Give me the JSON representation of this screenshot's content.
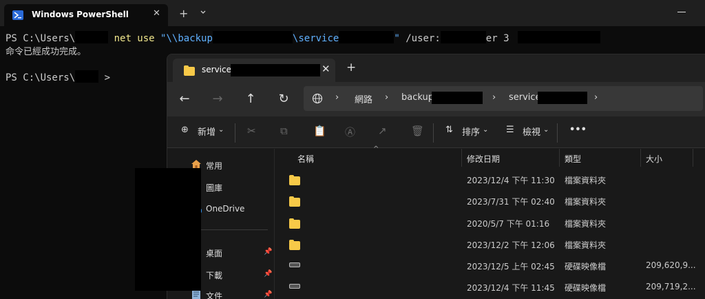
{
  "terminal": {
    "tab_title": "Windows PowerShell",
    "new_tab": "+",
    "line1_prompt": "PS C:\\Users\\",
    "line1_cmd": "net use",
    "line1_q1": "\"\\\\backup",
    "line1_q2": "\\service",
    "line1_q3": "\"",
    "line1_user": "/user:",
    "line1_tail": "er 3",
    "line2": "命令已經成功完成。",
    "line3_prompt": "PS C:\\Users\\",
    "line3_end": ">"
  },
  "explorer": {
    "tab_title": "service-",
    "new_tab": "+",
    "breadcrumb": [
      "網路",
      "backup",
      "service"
    ],
    "toolbar": {
      "new": "新增",
      "sort": "排序",
      "view": "檢視",
      "more": "•••"
    },
    "sidebar": [
      {
        "label": "常用",
        "icon": "home-icon"
      },
      {
        "label": "圖庫",
        "icon": "gallery-icon"
      },
      {
        "label": "OneDrive",
        "icon": "cloud-icon"
      },
      {
        "label": "桌面",
        "icon": "desktop-icon"
      },
      {
        "label": "下載",
        "icon": "download-icon"
      },
      {
        "label": "文件",
        "icon": "document-icon"
      }
    ],
    "columns": {
      "name": "名稱",
      "date": "修改日期",
      "type": "類型",
      "size": "大小"
    },
    "rows": [
      {
        "date": "2023/12/4 下午 11:30",
        "type": "檔案資料夾",
        "size": "",
        "icon": "folder-icon"
      },
      {
        "date": "2023/7/31 下午 02:40",
        "type": "檔案資料夾",
        "size": "",
        "icon": "folder-icon"
      },
      {
        "date": "2020/5/7 下午 01:16",
        "type": "檔案資料夾",
        "size": "",
        "icon": "folder-icon"
      },
      {
        "date": "2023/12/2 下午 12:06",
        "type": "檔案資料夾",
        "size": "",
        "icon": "folder-icon"
      },
      {
        "date": "2023/12/5 上午 02:45",
        "type": "硬碟映像檔",
        "size": "209,620,9...",
        "icon": "disk-image-icon"
      },
      {
        "date": "2023/12/4 下午 11:45",
        "type": "硬碟映像檔",
        "size": "209,719,2...",
        "icon": "disk-image-icon"
      }
    ]
  }
}
